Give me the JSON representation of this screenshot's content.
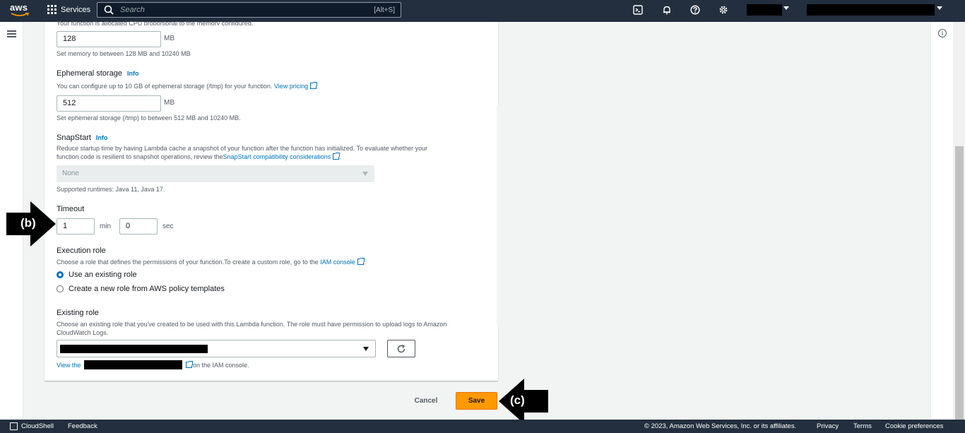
{
  "topnav": {
    "logo": "aws",
    "services_label": "Services",
    "search_placeholder": "Search",
    "search_shortcut": "[Alt+S]"
  },
  "memory": {
    "desc_top": "Your function is allocated CPU proportional to the memory configured.",
    "value": "128",
    "unit": "MB",
    "hint": "Set memory to between 128 MB and 10240 MB"
  },
  "ephemeral": {
    "label": "Ephemeral storage",
    "info": "Info",
    "desc": "You can configure up to 10 GB of ephemeral storage (/tmp) for your function.",
    "link": "View pricing",
    "value": "512",
    "unit": "MB",
    "hint": "Set ephemeral storage (/tmp) to between 512 MB and 10240 MB."
  },
  "snapstart": {
    "label": "SnapStart",
    "info": "Info",
    "desc1": "Reduce startup time by having Lambda cache a snapshot of your function after the function has initialized. To evaluate whether your",
    "desc2": "function code is resilient to snapshot operations, review the",
    "link": "SnapStart compatibility considerations",
    "desc2_end": ".",
    "select_value": "None",
    "hint": "Supported runtimes: Java 11, Java 17."
  },
  "timeout": {
    "label": "Timeout",
    "min_value": "1",
    "min_unit": "min",
    "sec_value": "0",
    "sec_unit": "sec"
  },
  "execution_role": {
    "label": "Execution role",
    "desc": "Choose a role that defines the permissions of your function.To create a custom role, go to the",
    "link": "IAM console",
    "desc_end": ".",
    "option1": "Use an existing role",
    "option2": "Create a new role from AWS policy templates"
  },
  "existing_role": {
    "label": "Existing role",
    "desc1": "Choose an existing role that you've created to be used with this Lambda function. The role must have permission to upload logs to Amazon",
    "desc2": "CloudWatch Logs.",
    "view_prefix": "View the",
    "view_suffix": "on the IAM console."
  },
  "actions": {
    "cancel": "Cancel",
    "save": "Save"
  },
  "annotations": {
    "b": "(b)",
    "c": "(c)"
  },
  "footer": {
    "cloudshell": "CloudShell",
    "feedback": "Feedback",
    "copyright": "© 2023, Amazon Web Services, Inc. or its affiliates.",
    "privacy": "Privacy",
    "terms": "Terms",
    "cookies": "Cookie preferences"
  },
  "colors": {
    "nav_bg": "#232f3e",
    "link": "#0073bb",
    "save_button": "#ff9900"
  }
}
